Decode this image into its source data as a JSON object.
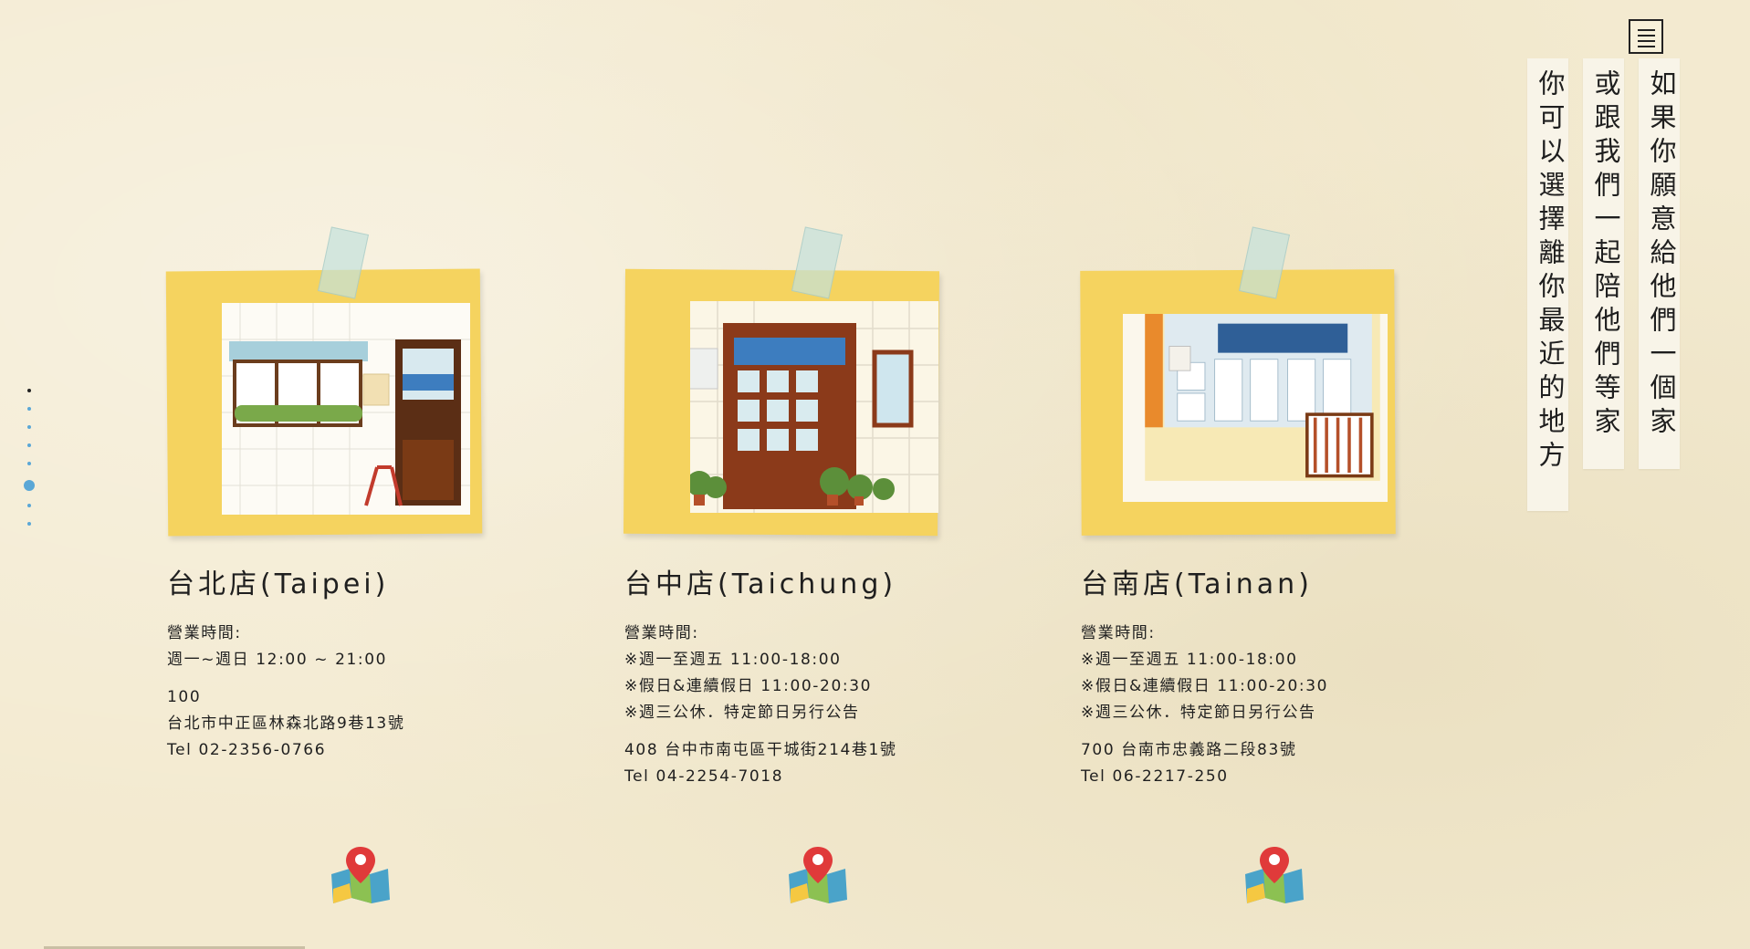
{
  "nav": {
    "menu_icon": "hamburger-icon",
    "section_dots": 8,
    "active_dot": 6
  },
  "intro": {
    "lines": [
      "如果你願意給他們一個家",
      "或跟我們一起陪他們等家",
      "你可以選擇離你最近的地方"
    ]
  },
  "stores": [
    {
      "name": "台北店(Taipei)",
      "hours_label": "營業時間:",
      "hours": [
        "週一~週日 12:00 ~ 21:00"
      ],
      "address": [
        "100",
        "台北市中正區林森北路9巷13號"
      ],
      "phone": "Tel 02-2356-0766",
      "map_icon": "map-pin-icon"
    },
    {
      "name": "台中店(Taichung)",
      "hours_label": "營業時間:",
      "hours": [
        "※週一至週五 11:00-18:00",
        "※假日&連續假日 11:00-20:30",
        "※週三公休．特定節日另行公告"
      ],
      "address": [
        "408 台中市南屯區干城街214巷1號"
      ],
      "phone": "Tel 04-2254-7018",
      "map_icon": "map-pin-icon"
    },
    {
      "name": "台南店(Tainan)",
      "hours_label": "營業時間:",
      "hours": [
        "※週一至週五 11:00-18:00",
        "※假日&連續假日 11:00-20:30",
        "※週三公休．特定節日另行公告"
      ],
      "address": [
        "700 台南市忠義路二段83號"
      ],
      "phone": "Tel 06-2217-250",
      "map_icon": "map-pin-icon"
    }
  ],
  "colors": {
    "background": "#f3ead0",
    "sticky_note": "#f5d35f",
    "accent_blue": "#5aa7d6",
    "pin_red": "#e03a3a"
  }
}
